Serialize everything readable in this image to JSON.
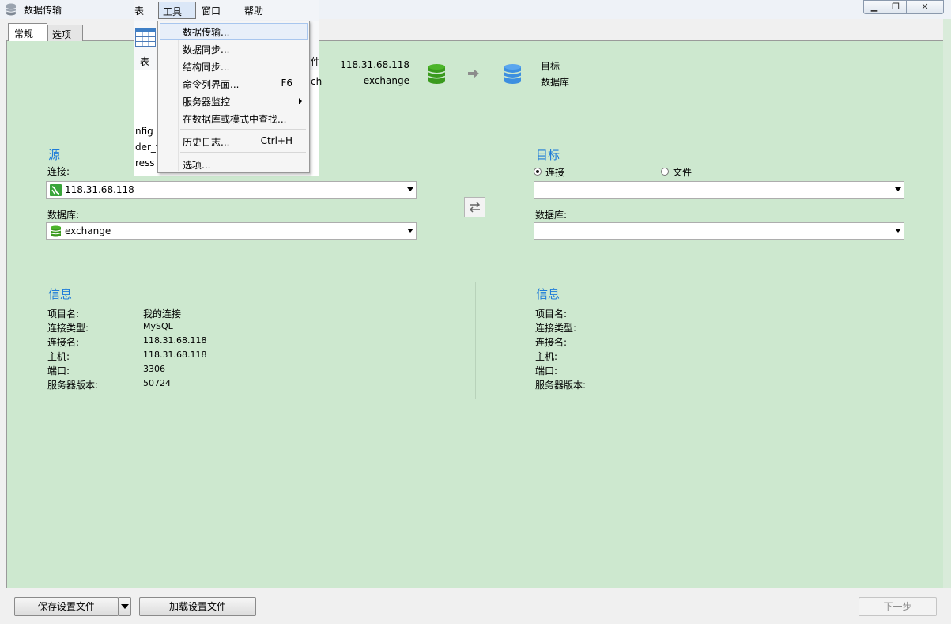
{
  "window": {
    "title": "数据传输",
    "icon": "database-icon",
    "controls": [
      "minimize-icon",
      "maximize-icon",
      "close-icon"
    ]
  },
  "tabs": [
    {
      "label": "常规",
      "active": true
    },
    {
      "label": "选项",
      "active": false
    }
  ],
  "header": {
    "source_host": "118.31.68.118",
    "source_db": "exchange",
    "target_line1": "目标",
    "target_line2": "数据库",
    "source_color": "#3a9a1e",
    "target_color": "#3d8fe0"
  },
  "source": {
    "title": "源",
    "connection_label": "连接:",
    "connection_value": "118.31.68.118",
    "database_label": "数据库:",
    "database_value": "exchange"
  },
  "target": {
    "title": "目标",
    "radio_connection": "连接",
    "radio_file": "文件",
    "selected": "连接",
    "database_label": "数据库:",
    "connection_value": "",
    "database_value": ""
  },
  "source_info": {
    "title": "信息",
    "rows": [
      {
        "label": "项目名:",
        "value": "我的连接"
      },
      {
        "label": "连接类型:",
        "value": "MySQL"
      },
      {
        "label": "连接名:",
        "value": "118.31.68.118"
      },
      {
        "label": "主机:",
        "value": "118.31.68.118"
      },
      {
        "label": "端口:",
        "value": "3306"
      },
      {
        "label": "服务器版本:",
        "value": "50724"
      }
    ]
  },
  "target_info": {
    "title": "信息",
    "rows": [
      {
        "label": "项目名:",
        "value": ""
      },
      {
        "label": "连接类型:",
        "value": ""
      },
      {
        "label": "连接名:",
        "value": ""
      },
      {
        "label": "主机:",
        "value": ""
      },
      {
        "label": "端口:",
        "value": ""
      },
      {
        "label": "服务器版本:",
        "value": ""
      }
    ]
  },
  "footer": {
    "save_settings": "保存设置文件",
    "load_settings": "加载设置文件",
    "next": "下一步"
  },
  "background_window": {
    "menu_partial": "表",
    "menu_tools": "工具",
    "menu_window": "窗口",
    "menu_help": "帮助",
    "toolbar_table": "表",
    "toolbar_partial_1": "件",
    "toolbar_partial_2": "ch",
    "list_items": [
      "nfig",
      "der_f",
      "ress"
    ]
  },
  "tools_menu": {
    "items": [
      {
        "label": "数据传输...",
        "shortcut": "",
        "highlighted": true,
        "submenu": false
      },
      {
        "label": "数据同步...",
        "shortcut": "",
        "highlighted": false,
        "submenu": false
      },
      {
        "label": "结构同步...",
        "shortcut": "",
        "highlighted": false,
        "submenu": false
      },
      {
        "label": "命令列界面...",
        "shortcut": "F6",
        "highlighted": false,
        "submenu": false
      },
      {
        "label": "服务器监控",
        "shortcut": "",
        "highlighted": false,
        "submenu": true
      },
      {
        "label": "在数据库或模式中查找...",
        "shortcut": "",
        "highlighted": false,
        "submenu": false
      },
      {
        "label": "历史日志...",
        "shortcut": "Ctrl+H",
        "highlighted": false,
        "submenu": false
      },
      {
        "label": "选项...",
        "shortcut": "",
        "highlighted": false,
        "submenu": false
      }
    ]
  }
}
